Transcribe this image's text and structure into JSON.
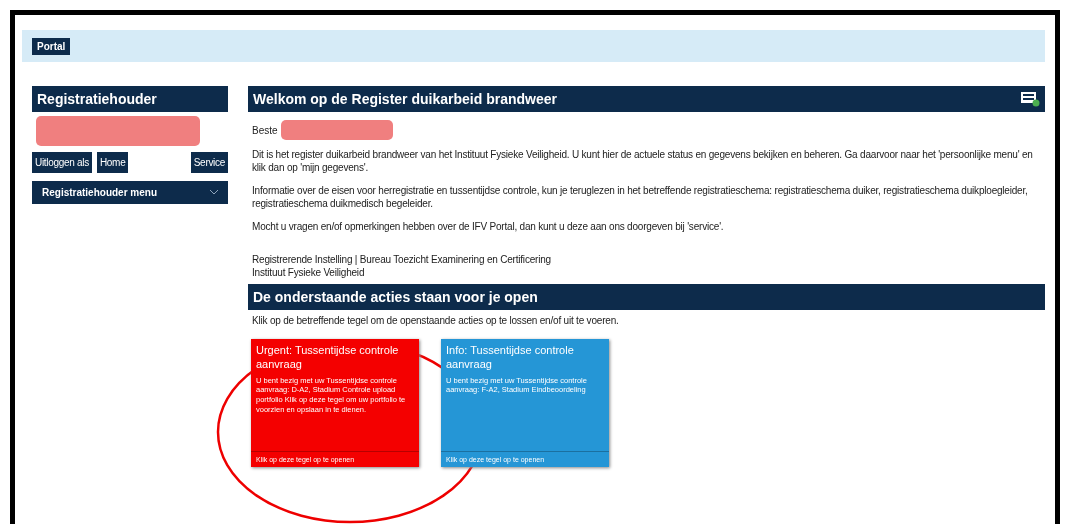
{
  "nav": {
    "tab": "Portal"
  },
  "sidebar": {
    "title": "Registratiehouder",
    "buttons": [
      "Uitloggen als",
      "Home",
      "Service"
    ],
    "menu": "Registratiehouder menu"
  },
  "welcome": {
    "title": "Welkom op de Register duikarbeid brandweer",
    "greeting": "Beste",
    "paragraphs": [
      "Dit is het register duikarbeid brandweer van het Instituut Fysieke Veiligheid. U kunt hier de actuele status en gegevens bekijken en beheren. Ga daarvoor naar het 'persoonlijke menu' en klik dan op 'mijn gegevens'.",
      "Informatie over de eisen voor herregistratie en tussentijdse controle, kun je teruglezen in het betreffende registratieschema: registratieschema duiker, registratieschema duikploegleider, registratieschema duikmedisch begeleider.",
      "Mocht u vragen en/of opmerkingen hebben over de IFV Portal, dan kunt u deze aan ons doorgeven bij 'service'."
    ],
    "signature": [
      "Registrerende Instelling | Bureau Toezicht Examinering en Certificering",
      "Instituut Fysieke Veiligheid"
    ]
  },
  "actions": {
    "title": "De onderstaande acties staan voor je open",
    "intro": "Klik op de betreffende tegel om de openstaande acties op te lossen en/of uit te voeren.",
    "tiles": [
      {
        "kind": "urgent",
        "title": "Urgent: Tussentijdse controle aanvraag",
        "body": "U bent bezig met uw Tussentijdse controle aanvraag: D-A2, Stadium Controle upload portfolio Klik op deze tegel om uw portfolio te voorzien en opslaan in te dienen.",
        "footer": "Klik op deze tegel op te openen"
      },
      {
        "kind": "info",
        "title": "Info: Tussentijdse controle aanvraag",
        "body": "U bent bezig met uw Tussentijdse controle aanvraag: F-A2, Stadium Eindbeoordeling",
        "footer": "Klik op deze tegel op te openen"
      }
    ]
  }
}
